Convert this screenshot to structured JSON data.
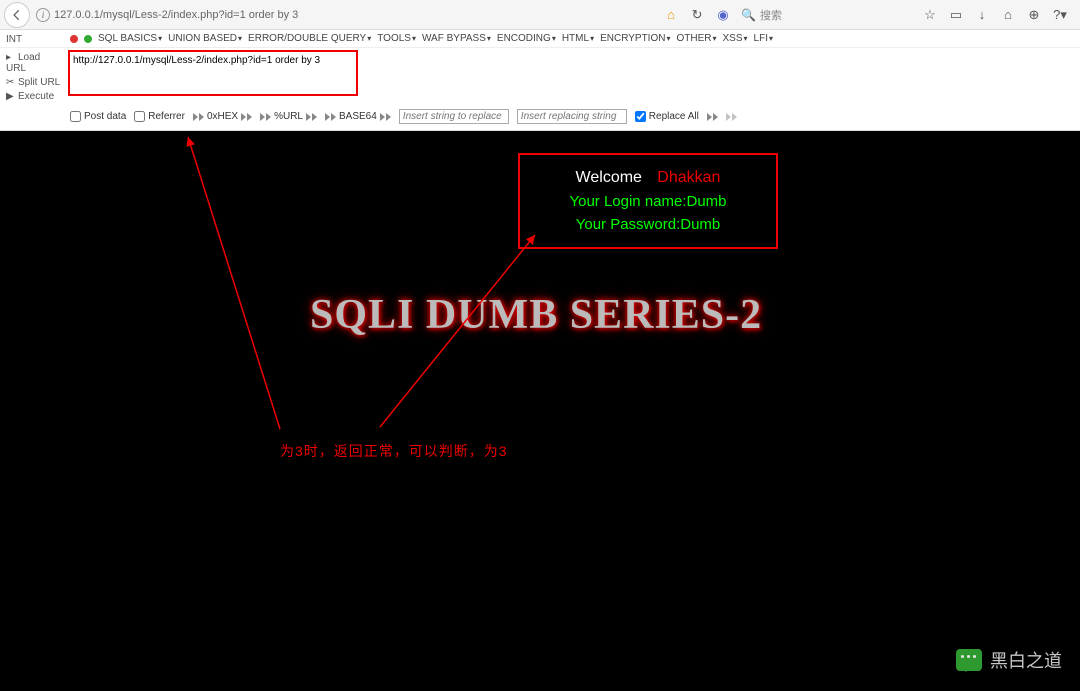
{
  "address_bar": {
    "url": "127.0.0.1/mysql/Less-2/index.php?id=1 order by 3",
    "search_placeholder": "搜索"
  },
  "hackbar": {
    "int_label": "INT",
    "menu": [
      "SQL BASICS",
      "UNION BASED",
      "ERROR/DOUBLE QUERY",
      "TOOLS",
      "WAF BYPASS",
      "ENCODING",
      "HTML",
      "ENCRYPTION",
      "OTHER",
      "XSS",
      "LFI"
    ],
    "sidebar": {
      "load": "Load URL",
      "split": "Split URL",
      "execute": "Execute"
    },
    "url_value": "http://127.0.0.1/mysql/Less-2/index.php?id=1 order by 3",
    "tools": {
      "post_data": "Post data",
      "referrer": "Referrer",
      "hex": "0xHEX",
      "urlenc": "%URL",
      "base64": "BASE64",
      "insert1_ph": "Insert string to replace",
      "insert2_ph": "Insert replacing string",
      "replace_all": "Replace All"
    }
  },
  "page": {
    "welcome_label": "Welcome",
    "welcome_name": "Dhakkan",
    "login_line": "Your Login name:Dumb",
    "password_line": "Your Password:Dumb",
    "banner": "SQLI DUMB SERIES-2",
    "annotation": "为3时，返回正常，可以判断，为3"
  },
  "watermark": "黑白之道"
}
